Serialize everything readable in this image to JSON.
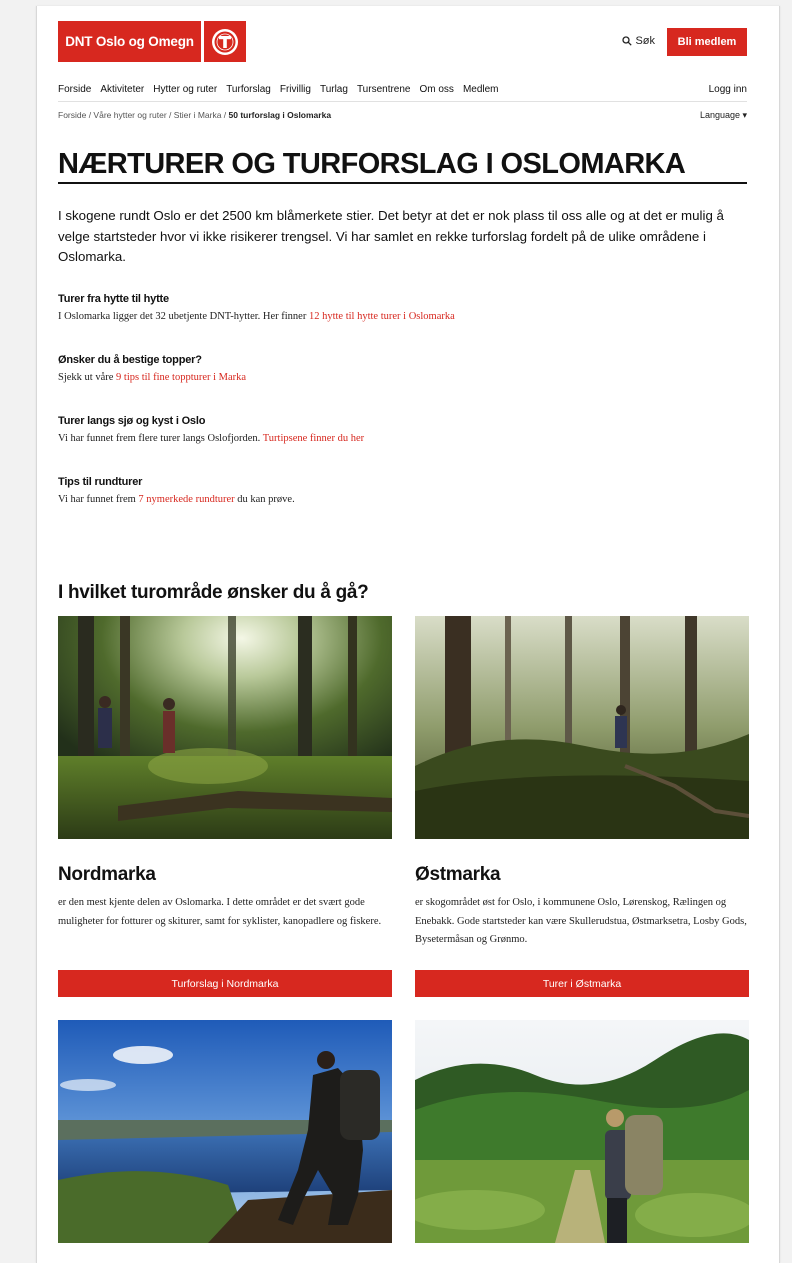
{
  "header": {
    "logo_text": "DNT Oslo og Omegn",
    "search_label": "Søk",
    "join_label": "Bli medlem",
    "login_label": "Logg inn",
    "brand_color": "#d7281f"
  },
  "nav": {
    "items": [
      "Forside",
      "Aktiviteter",
      "Hytter og ruter",
      "Turforslag",
      "Frivillig",
      "Turlag",
      "Tursentrene",
      "Om oss",
      "Medlem"
    ]
  },
  "breadcrumb": {
    "path": "Forside / Våre hytter og ruter / Stier i Marka / ",
    "current": "50 turforslag i Oslomarka"
  },
  "language_label": "Language ▾",
  "page": {
    "title": "NÆRTURER OG TURFORSLAG I OSLOMARKA",
    "lead": "I skogene rundt Oslo er det 2500 km blåmerkete stier. Det betyr at det er nok plass til oss alle og at det er mulig å velge startsteder hvor vi ikke risikerer trengsel. Vi har samlet en rekke turforslag fordelt på de ulike områdene i Oslomarka."
  },
  "sections": [
    {
      "heading": "Turer fra hytte til hytte",
      "text": "I Oslomarka ligger det 32 ubetjente DNT-hytter. Her finner ",
      "link": "12 hytte til hytte turer i Oslomarka",
      "after": ""
    },
    {
      "heading": "Ønsker du å bestige topper?",
      "text": "Sjekk ut våre ",
      "link": "9 tips til fine toppturer i Marka",
      "after": ""
    },
    {
      "heading": "Turer langs sjø og kyst i Oslo",
      "text": "Vi har funnet frem flere turer langs Oslofjorden. ",
      "link": "Turtipsene finner du her",
      "after": ""
    },
    {
      "heading": "Tips til rundturer",
      "text": "Vi har funnet frem ",
      "link": "7 nymerkede rundturer",
      "after": " du kan prøve."
    }
  ],
  "areas_heading": "I hvilket turområde ønsker du å gå?",
  "areas": [
    {
      "name": "Nordmarka",
      "description": "er den mest kjente delen av Oslomarka. I dette området er det svært gode muligheter for fotturer og skiturer, samt for syklister, kanopadlere og fiskere.",
      "button": "Turforslag i Nordmarka"
    },
    {
      "name": "Østmarka",
      "description": "er skogområdet øst for Oslo, i kommunene Oslo, Lørenskog, Rælingen og Enebakk. Gode startsteder kan være Skullerudstua, Østmarksetra, Losby Gods, Bysetermåsan og Grønmo.",
      "button": "Turer i Østmarka"
    }
  ]
}
